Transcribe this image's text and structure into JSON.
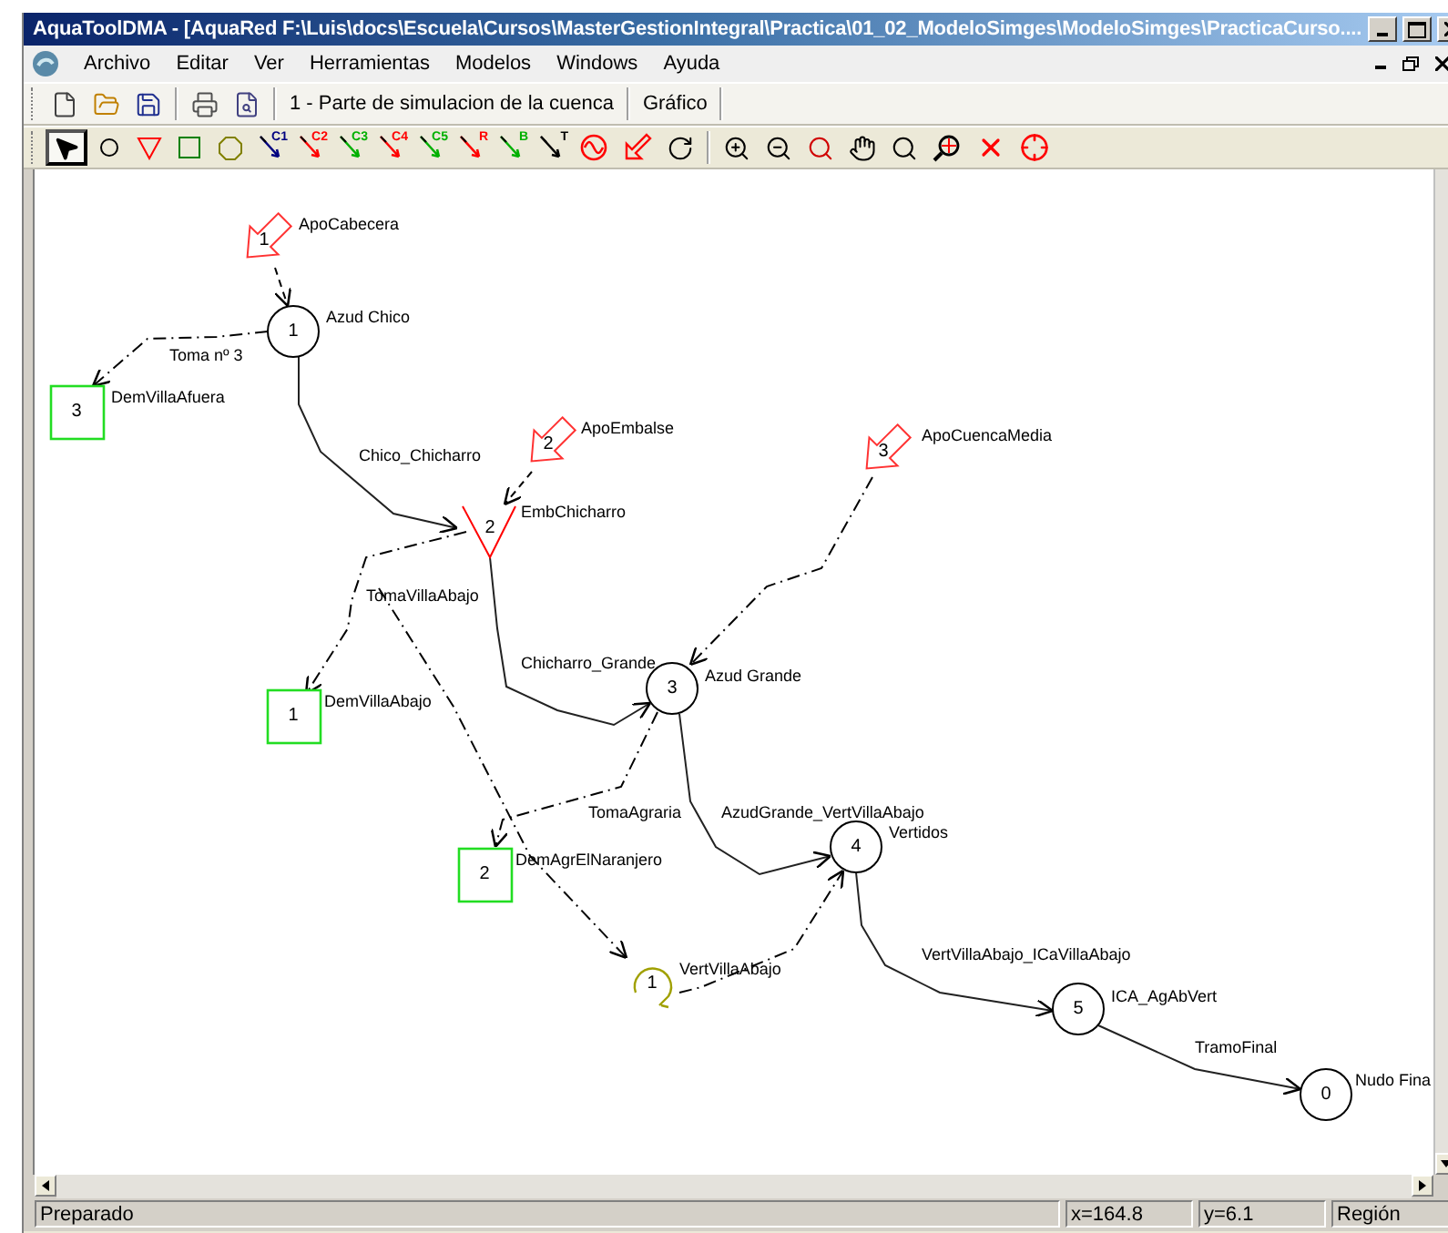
{
  "window": {
    "title": "AquaToolDMA - [AquaRed F:\\Luis\\docs\\Escuela\\Cursos\\MasterGestionIntegral\\Practica\\01_02_ModeloSimges\\ModeloSimges\\PracticaCurso...."
  },
  "menu": [
    "Archivo",
    "Editar",
    "Ver",
    "Herramientas",
    "Modelos",
    "Windows",
    "Ayuda"
  ],
  "toolbar": {
    "buttons": [
      {
        "kind": "new"
      },
      {
        "kind": "open"
      },
      {
        "kind": "save"
      },
      {
        "kind": "print"
      },
      {
        "kind": "preview"
      }
    ],
    "scheme": "1 - Parte de simulacion de la cuenca",
    "view": "Gráfico"
  },
  "tools": [
    {
      "kind": "pointer",
      "selected": true
    },
    {
      "kind": "junction",
      "selected": false
    },
    {
      "kind": "reservoir",
      "selected": false
    },
    {
      "kind": "demand",
      "selected": false
    },
    {
      "kind": "aquifer",
      "selected": false
    },
    {
      "kind": "link",
      "label": "C1",
      "color": "#000080",
      "selected": false
    },
    {
      "kind": "link",
      "label": "C2",
      "color": "#ff0000",
      "selected": false
    },
    {
      "kind": "link",
      "label": "C3",
      "color": "#00b000",
      "selected": false
    },
    {
      "kind": "link",
      "label": "C4",
      "color": "#ff0000",
      "selected": false
    },
    {
      "kind": "link",
      "label": "C5",
      "color": "#00b000",
      "selected": false
    },
    {
      "kind": "link",
      "label": "R",
      "color": "#ff0000",
      "selected": false
    },
    {
      "kind": "link",
      "label": "B",
      "color": "#00b000",
      "selected": false
    },
    {
      "kind": "link",
      "label": "T",
      "color": "#000000",
      "selected": false
    },
    {
      "kind": "return",
      "selected": false
    },
    {
      "kind": "inflow",
      "selected": false
    },
    {
      "kind": "rotate",
      "selected": false
    },
    {
      "kind": "zoom-in",
      "selected": false
    },
    {
      "kind": "zoom-out",
      "selected": false
    },
    {
      "kind": "zoom-window",
      "selected": false
    },
    {
      "kind": "pan",
      "selected": false
    },
    {
      "kind": "zoom",
      "selected": false
    },
    {
      "kind": "zoom-extents",
      "selected": false
    },
    {
      "kind": "delete",
      "selected": false
    },
    {
      "kind": "target",
      "selected": false
    }
  ],
  "canvas": {
    "nodes": [
      {
        "kind": "inflow",
        "number": "1",
        "name": "ApoCabecera"
      },
      {
        "kind": "junction",
        "number": "1",
        "name": "Azud Chico"
      },
      {
        "kind": "demand",
        "number": "3",
        "name": "DemVillaAfuera"
      },
      {
        "kind": "inflow",
        "number": "2",
        "name": "ApoEmbalse"
      },
      {
        "kind": "inflow",
        "number": "3",
        "name": "ApoCuencaMedia"
      },
      {
        "kind": "reservoir",
        "number": "2",
        "name": "EmbChicharro"
      },
      {
        "kind": "demand",
        "number": "1",
        "name": "DemVillaAbajo"
      },
      {
        "kind": "junction",
        "number": "3",
        "name": "Azud Grande"
      },
      {
        "kind": "junction",
        "number": "4",
        "name": "Vertidos"
      },
      {
        "kind": "demand",
        "number": "2",
        "name": "DemAgrElNaranjero"
      },
      {
        "kind": "return",
        "number": "1",
        "name": "VertVillaAbajo"
      },
      {
        "kind": "junction",
        "number": "5",
        "name": "ICA_AgAbVert"
      },
      {
        "kind": "junction",
        "number": "0",
        "name": "Nudo Fina"
      }
    ],
    "links": [
      {
        "kind": "inflow"
      },
      {
        "kind": "intake",
        "label": "Toma nº 3"
      },
      {
        "kind": "conduction",
        "label": "Chico_Chicharro"
      },
      {
        "kind": "inflow"
      },
      {
        "kind": "intake"
      },
      {
        "kind": "intake",
        "label": "TomaVillaAbajo"
      },
      {
        "kind": "conduction",
        "label": "Chicharro_Grande"
      },
      {
        "kind": "intake",
        "label": "TomaAgraria"
      },
      {
        "kind": "conduction",
        "label": "AzudGrande_VertVillaAbajo"
      },
      {
        "kind": "intake"
      },
      {
        "kind": "intake"
      },
      {
        "kind": "conduction",
        "label": "VertVillaAbajo_ICaVillaAbajo"
      },
      {
        "kind": "conduction",
        "label": "TramoFinal"
      }
    ]
  },
  "status_bar": {
    "message": "Preparado",
    "x": "x=164.8",
    "y": "y=6.1",
    "mode": "Región"
  }
}
